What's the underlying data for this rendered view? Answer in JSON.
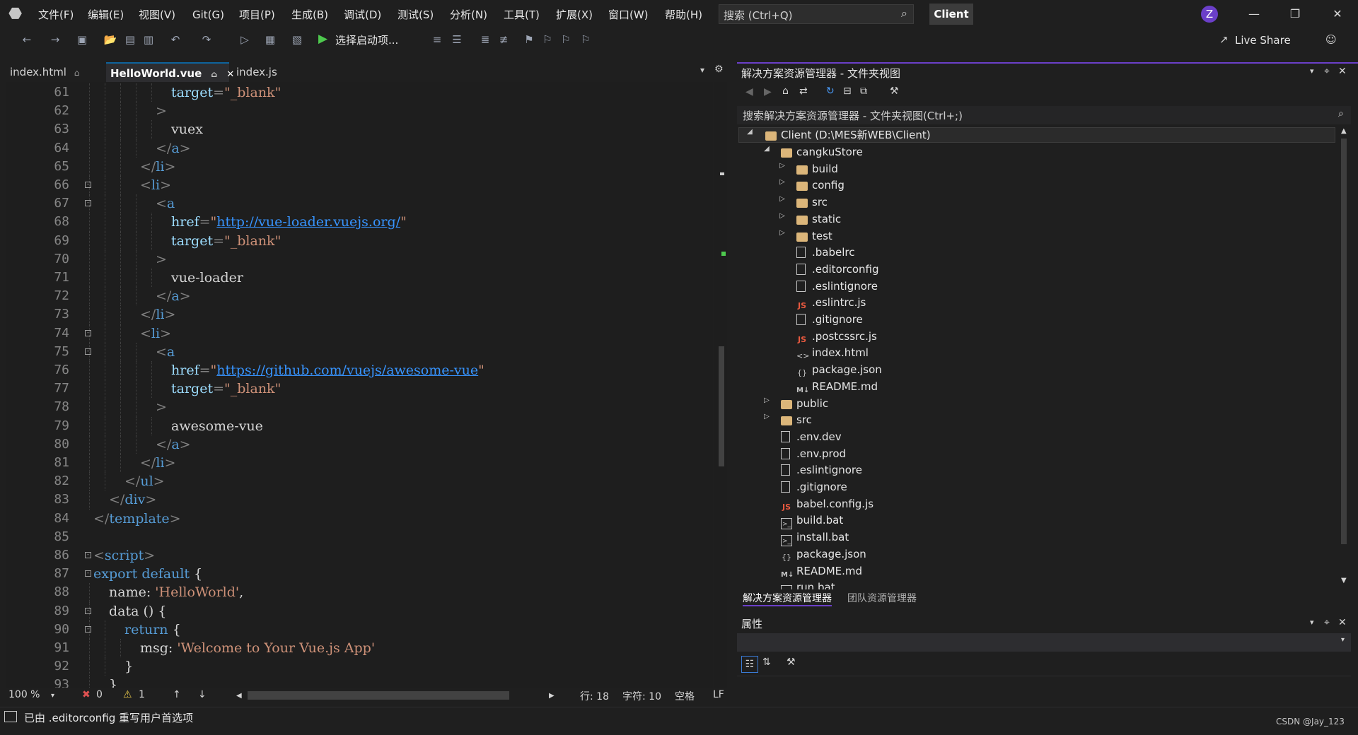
{
  "menu": {
    "items": [
      "文件(F)",
      "编辑(E)",
      "视图(V)",
      "Git(G)",
      "项目(P)",
      "生成(B)",
      "调试(D)",
      "测试(S)",
      "分析(N)",
      "工具(T)",
      "扩展(X)",
      "窗口(W)",
      "帮助(H)"
    ],
    "search_placeholder": "搜索 (Ctrl+Q)",
    "solution_name": "Client",
    "avatar_letter": "Z"
  },
  "toolbar": {
    "run_label": "选择启动项...",
    "live_share": "Live Share"
  },
  "editor": {
    "tabs": [
      {
        "label": "index.html",
        "active": false
      },
      {
        "label": "HelloWorld.vue",
        "active": true
      },
      {
        "label": "index.js",
        "active": false
      }
    ],
    "lines": [
      {
        "n": "61",
        "indent": 5,
        "parts": [
          {
            "c": "attr",
            "t": "target"
          },
          {
            "c": "punct",
            "t": "="
          },
          {
            "c": "str",
            "t": "\"_blank\""
          }
        ]
      },
      {
        "n": "62",
        "indent": 4,
        "parts": [
          {
            "c": "punct",
            "t": ">"
          }
        ]
      },
      {
        "n": "63",
        "indent": 5,
        "parts": [
          {
            "c": "txt",
            "t": "vuex"
          }
        ]
      },
      {
        "n": "64",
        "indent": 4,
        "parts": [
          {
            "c": "punct",
            "t": "</"
          },
          {
            "c": "tag",
            "t": "a"
          },
          {
            "c": "punct",
            "t": ">"
          }
        ]
      },
      {
        "n": "65",
        "indent": 3,
        "parts": [
          {
            "c": "punct",
            "t": "</"
          },
          {
            "c": "tag",
            "t": "li"
          },
          {
            "c": "punct",
            "t": ">"
          }
        ]
      },
      {
        "n": "66",
        "indent": 3,
        "fold": true,
        "parts": [
          {
            "c": "punct",
            "t": "<"
          },
          {
            "c": "tag",
            "t": "li"
          },
          {
            "c": "punct",
            "t": ">"
          }
        ]
      },
      {
        "n": "67",
        "indent": 4,
        "fold": true,
        "parts": [
          {
            "c": "punct",
            "t": "<"
          },
          {
            "c": "tag",
            "t": "a"
          }
        ]
      },
      {
        "n": "68",
        "indent": 5,
        "parts": [
          {
            "c": "attr",
            "t": "href"
          },
          {
            "c": "punct",
            "t": "="
          },
          {
            "c": "str",
            "t": "\""
          },
          {
            "c": "link",
            "t": "http://vue-loader.vuejs.org/"
          },
          {
            "c": "str",
            "t": "\""
          }
        ]
      },
      {
        "n": "69",
        "indent": 5,
        "parts": [
          {
            "c": "attr",
            "t": "target"
          },
          {
            "c": "punct",
            "t": "="
          },
          {
            "c": "str",
            "t": "\"_blank\""
          }
        ]
      },
      {
        "n": "70",
        "indent": 4,
        "parts": [
          {
            "c": "punct",
            "t": ">"
          }
        ]
      },
      {
        "n": "71",
        "indent": 5,
        "parts": [
          {
            "c": "txt",
            "t": "vue-loader"
          }
        ]
      },
      {
        "n": "72",
        "indent": 4,
        "parts": [
          {
            "c": "punct",
            "t": "</"
          },
          {
            "c": "tag",
            "t": "a"
          },
          {
            "c": "punct",
            "t": ">"
          }
        ]
      },
      {
        "n": "73",
        "indent": 3,
        "parts": [
          {
            "c": "punct",
            "t": "</"
          },
          {
            "c": "tag",
            "t": "li"
          },
          {
            "c": "punct",
            "t": ">"
          }
        ]
      },
      {
        "n": "74",
        "indent": 3,
        "fold": true,
        "parts": [
          {
            "c": "punct",
            "t": "<"
          },
          {
            "c": "tag",
            "t": "li"
          },
          {
            "c": "punct",
            "t": ">"
          }
        ]
      },
      {
        "n": "75",
        "indent": 4,
        "fold": true,
        "parts": [
          {
            "c": "punct",
            "t": "<"
          },
          {
            "c": "tag",
            "t": "a"
          }
        ]
      },
      {
        "n": "76",
        "indent": 5,
        "parts": [
          {
            "c": "attr",
            "t": "href"
          },
          {
            "c": "punct",
            "t": "="
          },
          {
            "c": "str",
            "t": "\""
          },
          {
            "c": "link",
            "t": "https://github.com/vuejs/awesome-vue"
          },
          {
            "c": "str",
            "t": "\""
          }
        ]
      },
      {
        "n": "77",
        "indent": 5,
        "parts": [
          {
            "c": "attr",
            "t": "target"
          },
          {
            "c": "punct",
            "t": "="
          },
          {
            "c": "str",
            "t": "\"_blank\""
          }
        ]
      },
      {
        "n": "78",
        "indent": 4,
        "parts": [
          {
            "c": "punct",
            "t": ">"
          }
        ]
      },
      {
        "n": "79",
        "indent": 5,
        "parts": [
          {
            "c": "txt",
            "t": "awesome-vue"
          }
        ]
      },
      {
        "n": "80",
        "indent": 4,
        "parts": [
          {
            "c": "punct",
            "t": "</"
          },
          {
            "c": "tag",
            "t": "a"
          },
          {
            "c": "punct",
            "t": ">"
          }
        ]
      },
      {
        "n": "81",
        "indent": 3,
        "parts": [
          {
            "c": "punct",
            "t": "</"
          },
          {
            "c": "tag",
            "t": "li"
          },
          {
            "c": "punct",
            "t": ">"
          }
        ]
      },
      {
        "n": "82",
        "indent": 2,
        "parts": [
          {
            "c": "punct",
            "t": "</"
          },
          {
            "c": "tag",
            "t": "ul"
          },
          {
            "c": "punct",
            "t": ">"
          }
        ]
      },
      {
        "n": "83",
        "indent": 1,
        "parts": [
          {
            "c": "punct",
            "t": "</"
          },
          {
            "c": "tag",
            "t": "div"
          },
          {
            "c": "punct",
            "t": ">"
          }
        ]
      },
      {
        "n": "84",
        "indent": 0,
        "parts": [
          {
            "c": "punct",
            "t": "</"
          },
          {
            "c": "tag",
            "t": "template"
          },
          {
            "c": "punct",
            "t": ">"
          }
        ]
      },
      {
        "n": "85",
        "indent": 0,
        "parts": []
      },
      {
        "n": "86",
        "indent": 0,
        "fold": true,
        "parts": [
          {
            "c": "punct",
            "t": "<"
          },
          {
            "c": "tag",
            "t": "script"
          },
          {
            "c": "punct",
            "t": ">"
          }
        ]
      },
      {
        "n": "87",
        "indent": 0,
        "fold": true,
        "parts": [
          {
            "c": "kw",
            "t": "export default"
          },
          {
            "c": "txt",
            "t": " {"
          }
        ]
      },
      {
        "n": "88",
        "indent": 1,
        "parts": [
          {
            "c": "txt",
            "t": "name: "
          },
          {
            "c": "str",
            "t": "'HelloWorld'"
          },
          {
            "c": "txt",
            "t": ","
          }
        ]
      },
      {
        "n": "89",
        "indent": 1,
        "fold": true,
        "parts": [
          {
            "c": "txt",
            "t": "data () {"
          }
        ]
      },
      {
        "n": "90",
        "indent": 2,
        "fold": true,
        "parts": [
          {
            "c": "kw",
            "t": "return"
          },
          {
            "c": "txt",
            "t": " {"
          }
        ]
      },
      {
        "n": "91",
        "indent": 3,
        "parts": [
          {
            "c": "txt",
            "t": "msg: "
          },
          {
            "c": "str",
            "t": "'Welcome to Your Vue.js App'"
          }
        ]
      },
      {
        "n": "92",
        "indent": 2,
        "parts": [
          {
            "c": "txt",
            "t": "}"
          }
        ]
      },
      {
        "n": "93",
        "indent": 1,
        "parts": [
          {
            "c": "txt",
            "t": "}"
          }
        ]
      }
    ],
    "status": {
      "zoom": "100 %",
      "errors": "0",
      "warnings": "1",
      "line": "行: 18",
      "char": "字符: 10",
      "whitespace": "空格",
      "eol": "LF"
    }
  },
  "solution_explorer": {
    "title": "解决方案资源管理器 - 文件夹视图",
    "search_placeholder": "搜索解决方案资源管理器 - 文件夹视图(Ctrl+;)",
    "root": "Client (D:\\MES新WEB\\Client)",
    "items": [
      {
        "label": "cangkuStore",
        "depth": 1,
        "type": "folder",
        "arrow": "open"
      },
      {
        "label": "build",
        "depth": 2,
        "type": "folder",
        "arrow": "closed"
      },
      {
        "label": "config",
        "depth": 2,
        "type": "folder",
        "arrow": "closed"
      },
      {
        "label": "src",
        "depth": 2,
        "type": "folder",
        "arrow": "closed"
      },
      {
        "label": "static",
        "depth": 2,
        "type": "folder",
        "arrow": "closed"
      },
      {
        "label": "test",
        "depth": 2,
        "type": "folder",
        "arrow": "closed"
      },
      {
        "label": ".babelrc",
        "depth": 2,
        "type": "file"
      },
      {
        "label": ".editorconfig",
        "depth": 2,
        "type": "file"
      },
      {
        "label": ".eslintignore",
        "depth": 2,
        "type": "file"
      },
      {
        "label": ".eslintrc.js",
        "depth": 2,
        "type": "js"
      },
      {
        "label": ".gitignore",
        "depth": 2,
        "type": "file"
      },
      {
        "label": ".postcssrc.js",
        "depth": 2,
        "type": "js"
      },
      {
        "label": "index.html",
        "depth": 2,
        "type": "html"
      },
      {
        "label": "package.json",
        "depth": 2,
        "type": "json"
      },
      {
        "label": "README.md",
        "depth": 2,
        "type": "md"
      },
      {
        "label": "public",
        "depth": 1,
        "type": "folder",
        "arrow": "closed"
      },
      {
        "label": "src",
        "depth": 1,
        "type": "folder",
        "arrow": "closed"
      },
      {
        "label": ".env.dev",
        "depth": 1,
        "type": "file"
      },
      {
        "label": ".env.prod",
        "depth": 1,
        "type": "file"
      },
      {
        "label": ".eslintignore",
        "depth": 1,
        "type": "file"
      },
      {
        "label": ".gitignore",
        "depth": 1,
        "type": "file"
      },
      {
        "label": "babel.config.js",
        "depth": 1,
        "type": "js"
      },
      {
        "label": "build.bat",
        "depth": 1,
        "type": "bat"
      },
      {
        "label": "install.bat",
        "depth": 1,
        "type": "bat"
      },
      {
        "label": "package.json",
        "depth": 1,
        "type": "json"
      },
      {
        "label": "README.md",
        "depth": 1,
        "type": "md"
      },
      {
        "label": "run.bat",
        "depth": 1,
        "type": "bat"
      }
    ],
    "bottom_tabs": [
      "解决方案资源管理器",
      "团队资源管理器"
    ]
  },
  "properties": {
    "title": "属性"
  },
  "statusbar": {
    "message": "已由 .editorconfig 重写用户首选项",
    "watermark": "CSDN @Jay_123"
  },
  "colors": {
    "accent": "#6b3fc8",
    "link": "#3794ff",
    "tag": "#569cd6",
    "string": "#ce9178",
    "attribute": "#9cdcfe",
    "run_green": "#4ec94e"
  }
}
